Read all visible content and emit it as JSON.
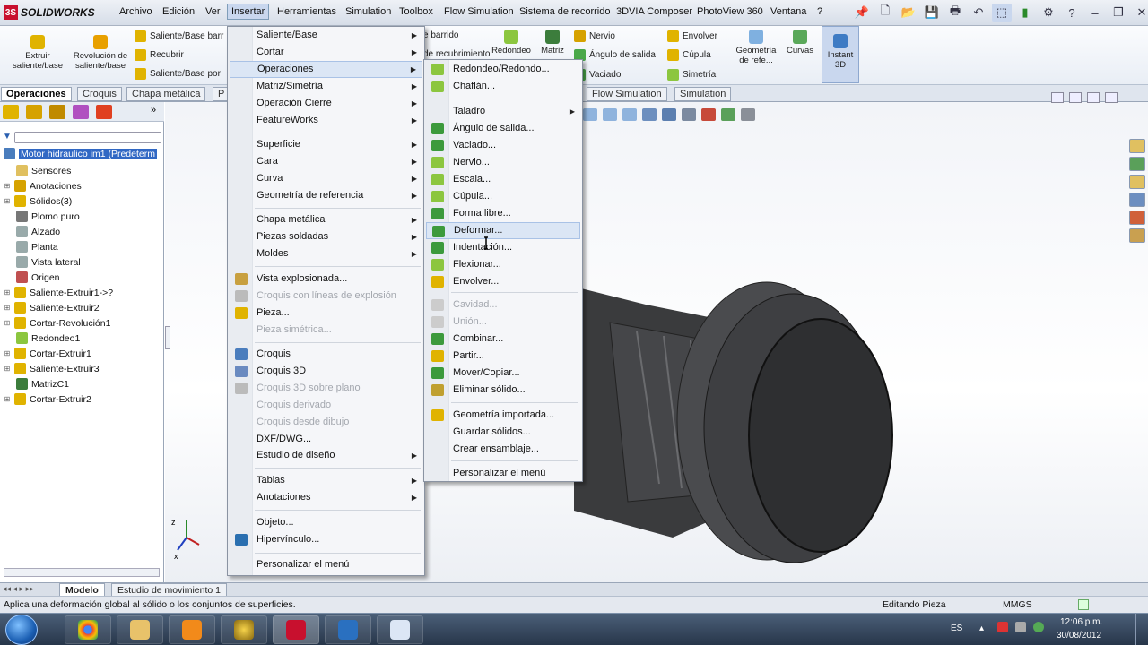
{
  "app": {
    "name": "SOLIDWORKS"
  },
  "menubar": {
    "items": [
      "Archivo",
      "Edición",
      "Ver",
      "Insertar",
      "Herramientas",
      "Simulation",
      "Toolbox",
      "Flow Simulation",
      "Sistema de recorrido",
      "3DVIA Composer",
      "PhotoView 360",
      "Ventana",
      "?"
    ]
  },
  "ribbon": {
    "extruir": "Extruir saliente/base",
    "revolucion": "Revolución de saliente/base",
    "barrido": "Saliente/Base barr",
    "recubrir": "Recubrir",
    "saliente_por": "Saliente/Base por",
    "barrido2": "e barrido",
    "recubrimiento": "de recubrimiento",
    "redondeo": "Redondeo",
    "matriz": "Matriz",
    "nervio": "Nervio",
    "angulo": "Ángulo de salida",
    "vaciado": "Vaciado",
    "envolver": "Envolver",
    "cupula": "Cúpula",
    "simetria": "Simetría",
    "geometria": "Geometría de refe...",
    "curvas": "Curvas",
    "instant3d": "Instant 3D"
  },
  "cmd_tabs": [
    "Operaciones",
    "Croquis",
    "Chapa metálica",
    "P",
    "Flow Simulation",
    "Simulation"
  ],
  "tree": {
    "root": "Motor hidraulico im1  (Predeterm",
    "items": [
      "Sensores",
      "Anotaciones",
      "Sólidos(3)",
      "Plomo puro",
      "Alzado",
      "Planta",
      "Vista lateral",
      "Origen",
      "Saliente-Extruir1->?",
      "Saliente-Extruir2",
      "Cortar-Revolución1",
      "Redondeo1",
      "Cortar-Extruir1",
      "Saliente-Extruir3",
      "MatrizC1",
      "Cortar-Extruir2"
    ]
  },
  "insert_menu": {
    "items": [
      {
        "label": "Saliente/Base",
        "sub": true
      },
      {
        "label": "Cortar",
        "sub": true
      },
      {
        "label": "Operaciones",
        "sub": true,
        "hl": true
      },
      {
        "label": "Matriz/Simetría",
        "sub": true
      },
      {
        "label": "Operación Cierre",
        "sub": true
      },
      {
        "label": "FeatureWorks",
        "sub": true
      },
      {
        "label": "Superficie",
        "sub": true
      },
      {
        "label": "Cara",
        "sub": true
      },
      {
        "label": "Curva",
        "sub": true
      },
      {
        "label": "Geometría de referencia",
        "sub": true
      },
      {
        "label": "Chapa metálica",
        "sub": true
      },
      {
        "label": "Piezas soldadas",
        "sub": true
      },
      {
        "label": "Moldes",
        "sub": true
      },
      {
        "label": "Vista explosionada..."
      },
      {
        "label": "Croquis con líneas de explosión",
        "dis": true
      },
      {
        "label": "Pieza..."
      },
      {
        "label": "Pieza simétrica...",
        "dis": true
      },
      {
        "label": "Croquis"
      },
      {
        "label": "Croquis 3D"
      },
      {
        "label": "Croquis 3D sobre plano",
        "dis": true
      },
      {
        "label": "Croquis derivado",
        "dis": true
      },
      {
        "label": "Croquis desde dibujo",
        "dis": true
      },
      {
        "label": "DXF/DWG..."
      },
      {
        "label": "Estudio de diseño",
        "sub": true
      },
      {
        "label": "Tablas",
        "sub": true
      },
      {
        "label": "Anotaciones",
        "sub": true
      },
      {
        "label": "Objeto..."
      },
      {
        "label": "Hipervínculo..."
      },
      {
        "label": "Personalizar el menú"
      }
    ]
  },
  "ops_menu": {
    "items": [
      {
        "label": "Redondeo/Redondo..."
      },
      {
        "label": "Chaflán..."
      },
      {
        "label": "Taladro",
        "sub": true
      },
      {
        "label": "Ángulo de salida..."
      },
      {
        "label": "Vaciado..."
      },
      {
        "label": "Nervio..."
      },
      {
        "label": "Escala..."
      },
      {
        "label": "Cúpula..."
      },
      {
        "label": "Forma libre..."
      },
      {
        "label": "Deformar...",
        "hl": true
      },
      {
        "label": "Indentación..."
      },
      {
        "label": "Flexionar..."
      },
      {
        "label": "Envolver..."
      },
      {
        "label": "Cavidad...",
        "dis": true
      },
      {
        "label": "Unión...",
        "dis": true
      },
      {
        "label": "Combinar..."
      },
      {
        "label": "Partir..."
      },
      {
        "label": "Mover/Copiar..."
      },
      {
        "label": "Eliminar sólido..."
      },
      {
        "label": "Geometría importada..."
      },
      {
        "label": "Guardar sólidos..."
      },
      {
        "label": "Crear ensamblaje..."
      },
      {
        "label": "Personalizar el menú"
      }
    ]
  },
  "bottom_tabs": [
    "Modelo",
    "Estudio de movimiento 1"
  ],
  "status": {
    "message": "Aplica una deformación global al sólido o los conjuntos de superficies.",
    "mode": "Editando Pieza",
    "units": "MMGS"
  },
  "tray": {
    "lang": "ES",
    "time": "12:06 p.m.",
    "date": "30/08/2012"
  }
}
